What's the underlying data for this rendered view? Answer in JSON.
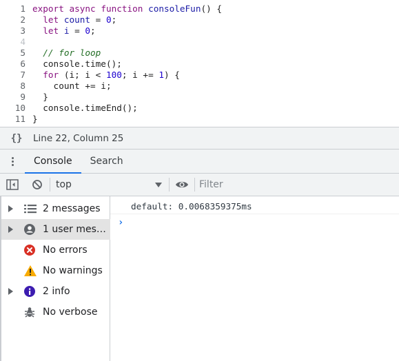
{
  "editor": {
    "lines": [
      {
        "num": "1",
        "parts": [
          {
            "t": "export",
            "c": "kw"
          },
          {
            "t": " ",
            "c": "tx"
          },
          {
            "t": "async",
            "c": "kw"
          },
          {
            "t": " ",
            "c": "tx"
          },
          {
            "t": "function",
            "c": "kw"
          },
          {
            "t": " ",
            "c": "tx"
          },
          {
            "t": "consoleFun",
            "c": "fn"
          },
          {
            "t": "() {",
            "c": "tx"
          }
        ]
      },
      {
        "num": "2",
        "parts": [
          {
            "t": "  ",
            "c": "tx"
          },
          {
            "t": "let",
            "c": "kw"
          },
          {
            "t": " ",
            "c": "tx"
          },
          {
            "t": "count",
            "c": "fn"
          },
          {
            "t": " = ",
            "c": "tx"
          },
          {
            "t": "0",
            "c": "num"
          },
          {
            "t": ";",
            "c": "tx"
          }
        ]
      },
      {
        "num": "3",
        "parts": [
          {
            "t": "  ",
            "c": "tx"
          },
          {
            "t": "let",
            "c": "kw"
          },
          {
            "t": " ",
            "c": "tx"
          },
          {
            "t": "i",
            "c": "fn"
          },
          {
            "t": " = ",
            "c": "tx"
          },
          {
            "t": "0",
            "c": "num"
          },
          {
            "t": ";",
            "c": "tx"
          }
        ]
      },
      {
        "num": "4",
        "dim": true,
        "parts": []
      },
      {
        "num": "5",
        "parts": [
          {
            "t": "  ",
            "c": "tx"
          },
          {
            "t": "// for loop",
            "c": "cm"
          }
        ]
      },
      {
        "num": "6",
        "parts": [
          {
            "t": "  console.time();",
            "c": "tx"
          }
        ]
      },
      {
        "num": "7",
        "parts": [
          {
            "t": "  ",
            "c": "tx"
          },
          {
            "t": "for",
            "c": "kw"
          },
          {
            "t": " (i; i < ",
            "c": "tx"
          },
          {
            "t": "100",
            "c": "num"
          },
          {
            "t": "; i += ",
            "c": "tx"
          },
          {
            "t": "1",
            "c": "num"
          },
          {
            "t": ") {",
            "c": "tx"
          }
        ]
      },
      {
        "num": "8",
        "parts": [
          {
            "t": "    count += i;",
            "c": "tx"
          }
        ]
      },
      {
        "num": "9",
        "parts": [
          {
            "t": "  }",
            "c": "tx"
          }
        ]
      },
      {
        "num": "10",
        "parts": [
          {
            "t": "  console.timeEnd();",
            "c": "tx"
          }
        ]
      },
      {
        "num": "11",
        "parts": [
          {
            "t": "}",
            "c": "tx"
          }
        ]
      }
    ]
  },
  "status": {
    "braces": "{}",
    "position": "Line 22, Column 25"
  },
  "drawer": {
    "tabs": [
      {
        "label": "Console",
        "active": true
      },
      {
        "label": "Search",
        "active": false
      }
    ]
  },
  "toolbar": {
    "context": "top",
    "filter_placeholder": "Filter"
  },
  "sidebar": {
    "items": [
      {
        "label": "2 messages",
        "icon": "list-icon",
        "expandable": true,
        "selected": false
      },
      {
        "label": "1 user mes…",
        "icon": "user-icon",
        "expandable": true,
        "selected": true
      },
      {
        "label": "No errors",
        "icon": "error-icon",
        "expandable": false,
        "selected": false
      },
      {
        "label": "No warnings",
        "icon": "warning-icon",
        "expandable": false,
        "selected": false
      },
      {
        "label": "2 info",
        "icon": "info-icon",
        "expandable": true,
        "selected": false
      },
      {
        "label": "No verbose",
        "icon": "bug-icon",
        "expandable": false,
        "selected": false
      }
    ]
  },
  "console": {
    "message": "default: 0.0068359375ms",
    "prompt": "›"
  },
  "colors": {
    "accent": "#1a73e8",
    "error": "#d93025",
    "warning": "#f9ab00",
    "info": "#3c1cb0"
  }
}
